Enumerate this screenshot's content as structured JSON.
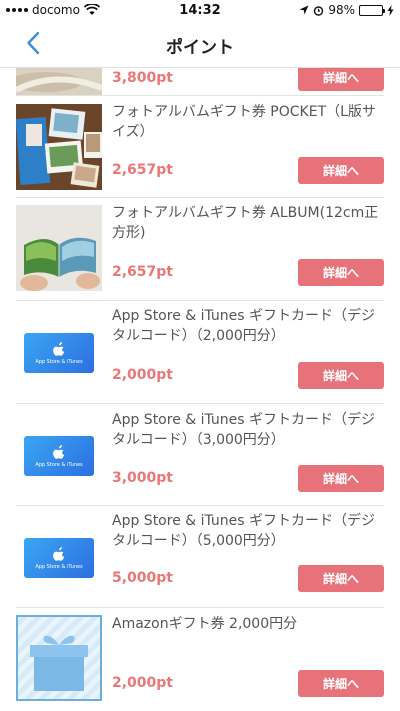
{
  "status_bar": {
    "carrier": "docomo",
    "time": "14:32",
    "battery": "98%",
    "battery_level": 0.98
  },
  "nav": {
    "title": "ポイント"
  },
  "items": [
    {
      "title": "",
      "price": "3,800pt",
      "button": "詳細へ"
    },
    {
      "title": "フォトアルバムギフト券 POCKET（L版サイズ）",
      "price": "2,657pt",
      "button": "詳細へ"
    },
    {
      "title": "フォトアルバムギフト券 ALBUM(12cm正方形)",
      "price": "2,657pt",
      "button": "詳細へ"
    },
    {
      "title": "App Store & iTunes ギフトカード（デジタルコード）（2,000円分）",
      "price": "2,000pt",
      "button": "詳細へ",
      "card_label": "App Store & iTunes"
    },
    {
      "title": "App Store & iTunes ギフトカード（デジタルコード）（3,000円分）",
      "price": "3,000pt",
      "button": "詳細へ",
      "card_label": "App Store & iTunes"
    },
    {
      "title": "App Store & iTunes ギフトカード（デジタルコード）（5,000円分）",
      "price": "5,000pt",
      "button": "詳細へ",
      "card_label": "App Store & iTunes"
    },
    {
      "title": "Amazonギフト券 2,000円分",
      "price": "2,000pt",
      "button": "詳細へ"
    }
  ],
  "colors": {
    "accent": "#e8727a",
    "price": "#e97777",
    "back_arrow": "#3a8fd6",
    "battery": "#4cd964"
  }
}
